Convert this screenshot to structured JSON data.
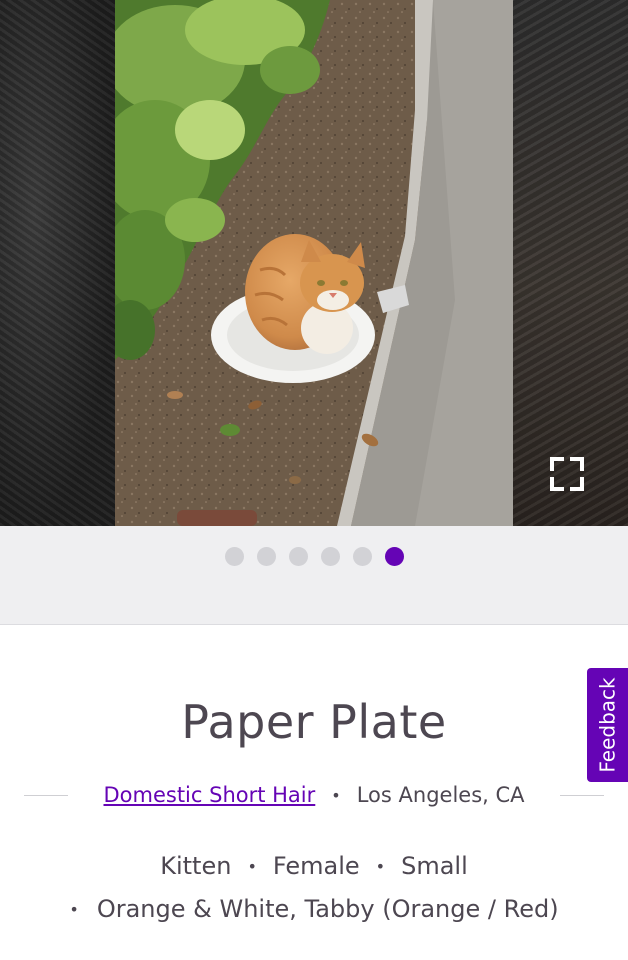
{
  "carousel": {
    "image_alt": "Orange and white tabby kitten sitting on a paper plate in the dirt beside a curb",
    "fullscreen_icon": "expand-icon",
    "dot_count": 6,
    "active_dot_index": 5
  },
  "pet": {
    "name": "Paper Plate",
    "breed": "Domestic Short Hair",
    "location": "Los Angeles, CA",
    "age": "Kitten",
    "gender": "Female",
    "size": "Small",
    "color": "Orange & White, Tabby (Orange / Red)"
  },
  "feedback": {
    "label": "Feedback"
  },
  "colors": {
    "accent": "#6504b5",
    "text": "#4d4751",
    "dot_inactive": "#d2d2d6",
    "dots_background": "#efeff1"
  }
}
